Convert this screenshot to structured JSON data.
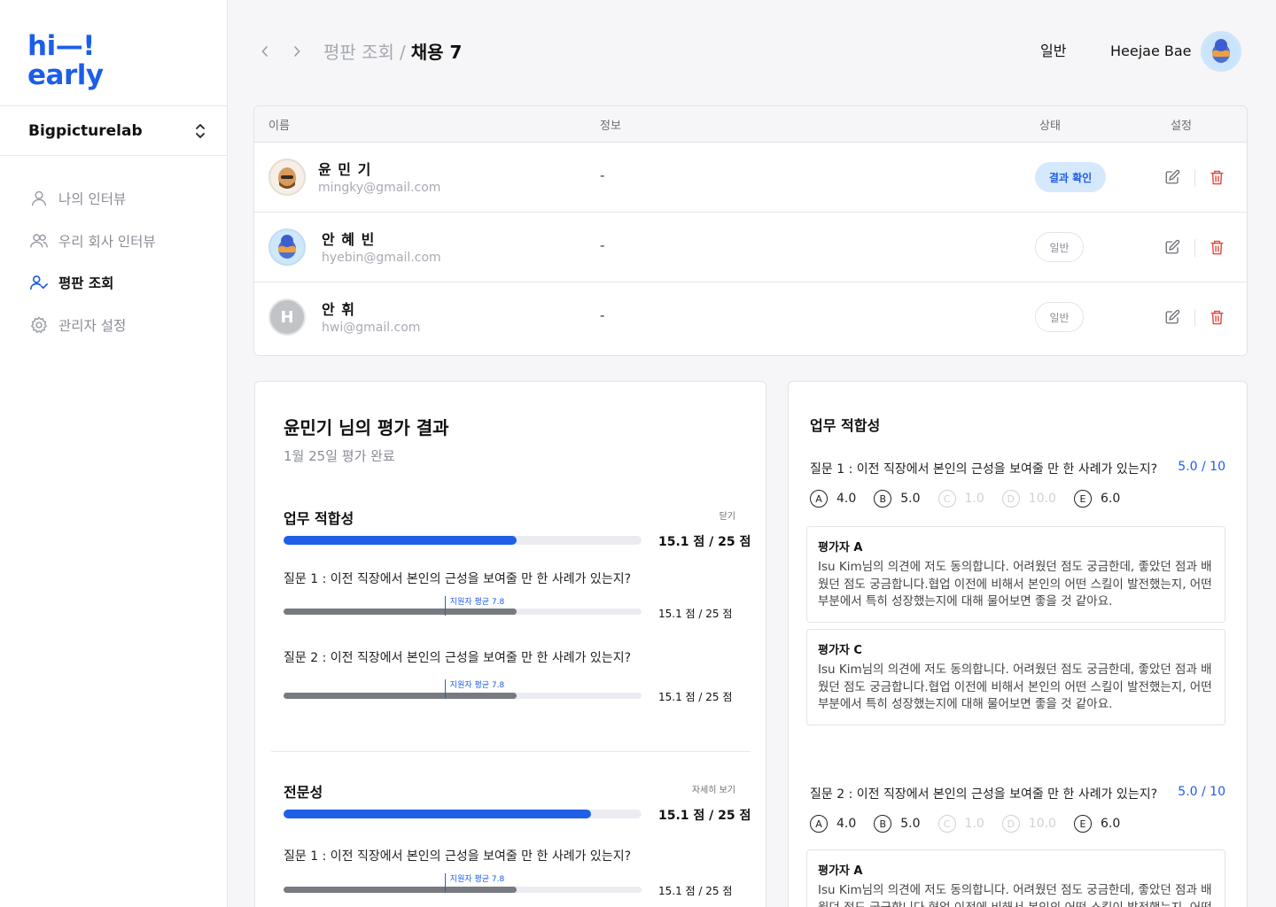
{
  "logo": {
    "line1": "hi—!",
    "line2": "early"
  },
  "sidebar": {
    "org": "Bigpicturelab",
    "items": [
      {
        "label": "나의 인터뷰",
        "icon": "user-icon",
        "active": false
      },
      {
        "label": "우리 회사 인터뷰",
        "icon": "users-icon",
        "active": false
      },
      {
        "label": "평판 조회",
        "icon": "user-check-icon",
        "active": true
      },
      {
        "label": "관리자 설정",
        "icon": "gear-icon",
        "active": false
      }
    ]
  },
  "header": {
    "breadcrumb_parent": "평판 조회",
    "breadcrumb_sep": "/",
    "breadcrumb_current": "채용 7",
    "role": "일반",
    "user_name": "Heejae Bae"
  },
  "table": {
    "columns": {
      "name": "이름",
      "info": "정보",
      "status": "상태",
      "settings": "설정"
    },
    "rows": [
      {
        "name": "윤 민 기",
        "email": "mingky@gmail.com",
        "info": "-",
        "status": "결과 확인",
        "avatar": "memoji-1"
      },
      {
        "name": "안 혜 빈",
        "email": "hyebin@gmail.com",
        "info": "-",
        "status": "일반",
        "avatar": "memoji-2"
      },
      {
        "name": "안 휘",
        "email": "hwi@gmail.com",
        "info": "-",
        "status": "일반",
        "avatar": "H"
      }
    ]
  },
  "evaluation": {
    "title": "윤민기 님의 평가 결과",
    "date": "1월 25일 평가 완료",
    "sections": [
      {
        "title": "업무 적합성",
        "link": "닫기",
        "progress": 0.65,
        "score": "15.1 점 / 25 점",
        "questions": [
          {
            "text": "질문 1 : 이전 직장에서 본인의 근성을 보여줄 만 한 사례가 있는지?",
            "progress": 0.65,
            "avg_label": "지원자 평균 7.8",
            "avg_pos": 0.45,
            "score": "15.1 점 / 25 점"
          },
          {
            "text": "질문 2 : 이전 직장에서 본인의 근성을 보여줄 만 한 사례가 있는지?",
            "progress": 0.65,
            "avg_label": "지원자 평균 7.8",
            "avg_pos": 0.45,
            "score": "15.1 점 / 25 점"
          }
        ]
      },
      {
        "title": "전문성",
        "link": "자세히 보기",
        "progress": 0.86,
        "score": "15.1 점 / 25 점",
        "questions": [
          {
            "text": "질문 1 : 이전 직장에서 본인의 근성을 보여줄 만 한 사례가 있는지?",
            "progress": 0.65,
            "avg_label": "지원자 평균 7.8",
            "avg_pos": 0.45,
            "score": "15.1 점 / 25 점"
          }
        ]
      }
    ]
  },
  "detail": {
    "title": "업무 적합성",
    "questions": [
      {
        "text": "질문 1 : 이전 직장에서 본인의 근성을 보여줄 만 한 사례가 있는지?",
        "score": "5.0 / 10",
        "options": [
          {
            "letter": "A",
            "value": "4.0",
            "dim": false
          },
          {
            "letter": "B",
            "value": "5.0",
            "dim": false
          },
          {
            "letter": "C",
            "value": "1.0",
            "dim": true
          },
          {
            "letter": "D",
            "value": "10.0",
            "dim": true
          },
          {
            "letter": "E",
            "value": "6.0",
            "dim": false
          }
        ],
        "comments": [
          {
            "author": "평가자 A",
            "body": "Isu Kim님의 의견에 저도 동의합니다. 어려웠던 점도 궁금한데, 좋았던 점과 배웠던 점도 궁금합니다.협업 이전에 비해서 본인의 어떤 스킬이 발전했는지, 어떤 부분에서 특히 성장했는지에 대해 물어보면 좋을 것 같아요."
          },
          {
            "author": "평가자 C",
            "body": "Isu Kim님의 의견에 저도 동의합니다. 어려웠던 점도 궁금한데, 좋았던 점과 배웠던 점도 궁금합니다.협업 이전에 비해서 본인의 어떤 스킬이 발전했는지, 어떤 부분에서 특히 성장했는지에 대해 물어보면 좋을 것 같아요."
          }
        ]
      },
      {
        "text": "질문 2 : 이전 직장에서 본인의 근성을 보여줄 만 한 사례가 있는지?",
        "score": "5.0 / 10",
        "options": [
          {
            "letter": "A",
            "value": "4.0",
            "dim": false
          },
          {
            "letter": "B",
            "value": "5.0",
            "dim": false
          },
          {
            "letter": "C",
            "value": "1.0",
            "dim": true
          },
          {
            "letter": "D",
            "value": "10.0",
            "dim": true
          },
          {
            "letter": "E",
            "value": "6.0",
            "dim": false
          }
        ],
        "comments": [
          {
            "author": "평가자 A",
            "body": "Isu Kim님의 의견에 저도 동의합니다. 어려웠던 점도 궁금한데, 좋았던 점과 배웠던 점도 궁금합니다.협업 이전에 비해서 본인의 어떤 스킬이 발전했는지, 어떤 부분에서 특히 성장했는지에 대해 물어보면 좋을 것 같아요."
          }
        ]
      }
    ]
  },
  "colors": {
    "brand": "#1d5ee8",
    "danger": "#e5453a",
    "status_bg": "#d6e8fb"
  }
}
